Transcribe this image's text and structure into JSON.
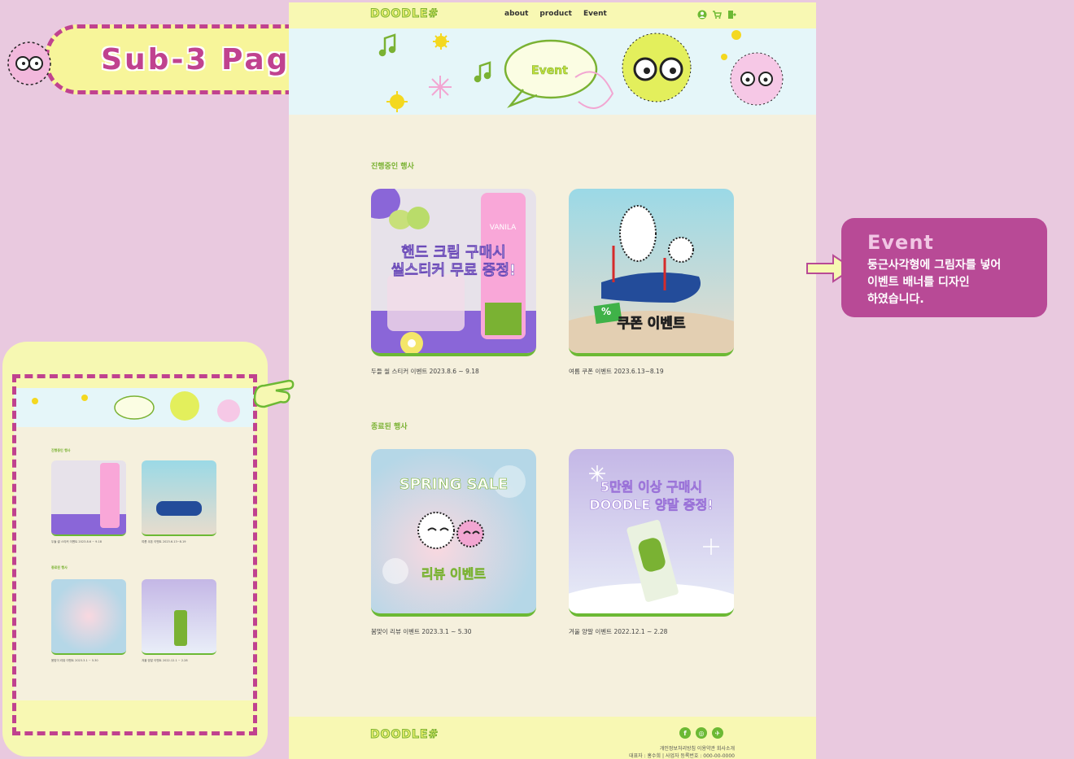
{
  "badge": {
    "label": "Sub-3 Page"
  },
  "nav": {
    "logo": "DOODLE#",
    "menu": [
      "about",
      "product",
      "Event"
    ]
  },
  "banner": {
    "bubble": "Event"
  },
  "sections": [
    {
      "title": "진행중인 행사"
    },
    {
      "title": "종료된 행사"
    }
  ],
  "events": [
    {
      "title": "핸드 크림 구매시\n씰스티커 무료 증정!",
      "caption": "두들 씰 스티커 이벤트 2023.8.6 ~ 9.18",
      "tube_text": "VANILA WITH ER"
    },
    {
      "title": "쿠폰 이벤트",
      "caption": "여름 쿠폰 이벤트 2023.6.13~8.19",
      "badge": "%"
    },
    {
      "title": "SPRING SALE",
      "sub": "리뷰 이벤트",
      "caption": "봄맞이 리뷰 이벤트 2023.3.1 ~ 5.30"
    },
    {
      "title": "5만원 이상 구매시\nDOODLE 양말 증정!",
      "caption": "겨울 양말 이벤트 2022.12.1 ~ 2.28"
    }
  ],
  "footer": {
    "logo": "DOODLE#",
    "links": "개인정보처리방침 이용약관 회사소개",
    "info": "대표자 : 홍수희  |  사업자 등록번호 : 000-00-0000"
  },
  "callout": {
    "title": "Event",
    "lines": [
      "둥근사각형에 그림자를 넣어",
      "이벤트 배너를 디자인",
      "하였습니다."
    ]
  },
  "colors": {
    "background": "#e9c9df",
    "accent_pink": "#c0428f",
    "callout": "#b84a96",
    "green": "#6cb934",
    "yellow": "#f8f8b3",
    "page": "#f5f0dd"
  }
}
